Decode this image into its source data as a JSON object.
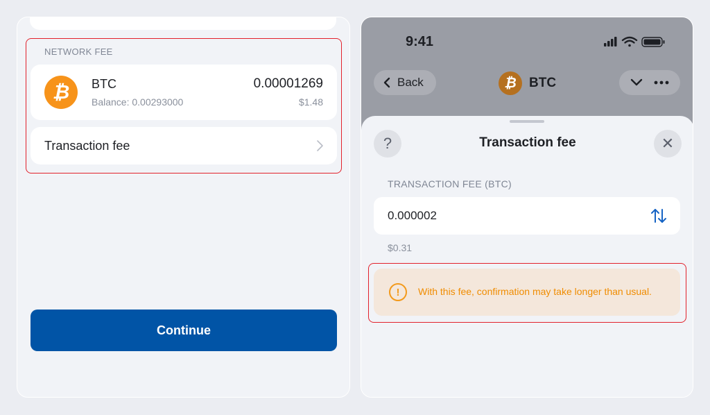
{
  "left_panel": {
    "network_fee_label": "NETWORK FEE",
    "coin": {
      "icon": "bitcoin-icon",
      "name": "BTC",
      "balance": "Balance: 0.00293000",
      "amount": "0.00001269",
      "fiat": "$1.48"
    },
    "transaction_fee_label": "Transaction fee",
    "continue_label": "Continue"
  },
  "right_panel": {
    "status_bar": {
      "time": "9:41",
      "icons": [
        "signal-icon",
        "wifi-icon",
        "battery-icon"
      ]
    },
    "nav": {
      "back_label": "Back",
      "title": "BTC"
    },
    "sheet": {
      "title": "Transaction fee",
      "help_symbol": "?",
      "close_symbol": "✕",
      "fee_label": "TRANSACTION FEE (BTC)",
      "fee_value": "0.000002",
      "fee_fiat": "$0.31",
      "warning_text": "With this fee, confirmation may take longer than usual."
    }
  },
  "colors": {
    "primary": "#0154a6",
    "bitcoin": "#f7931a",
    "warning": "#f08c00",
    "highlight": "#e2202a"
  }
}
